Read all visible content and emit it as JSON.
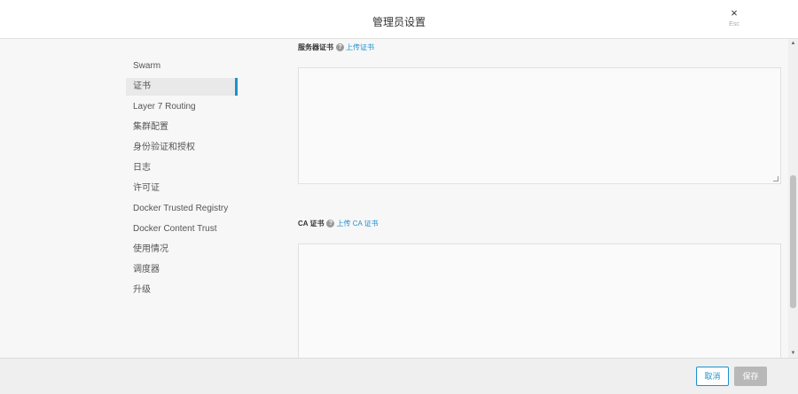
{
  "header": {
    "title": "管理员设置",
    "close_label": "×",
    "esc_hint": "Esc"
  },
  "sidebar": {
    "items": [
      {
        "label": "Swarm"
      },
      {
        "label": "证书"
      },
      {
        "label": "Layer 7 Routing"
      },
      {
        "label": "集群配置"
      },
      {
        "label": "身份验证和授权"
      },
      {
        "label": "日志"
      },
      {
        "label": "许可证"
      },
      {
        "label": "Docker Trusted Registry"
      },
      {
        "label": "Docker Content Trust"
      },
      {
        "label": "使用情况"
      },
      {
        "label": "调度器"
      },
      {
        "label": "升级"
      }
    ],
    "active_index": 1
  },
  "main": {
    "server_cert": {
      "label": "服务器证书",
      "help": "?",
      "upload_link": "上传证书",
      "value": ""
    },
    "ca_cert": {
      "label": "CA 证书",
      "help": "?",
      "upload_link": "上传 CA 证书",
      "value": ""
    }
  },
  "footer": {
    "cancel_label": "取消",
    "save_label": "保存"
  },
  "colors": {
    "accent": "#1a91d1",
    "disabled": "#b8b8b8"
  },
  "icons": {
    "close": "close-icon",
    "help": "help-icon",
    "scroll_up": "scroll-up-icon",
    "scroll_down": "scroll-down-icon"
  }
}
